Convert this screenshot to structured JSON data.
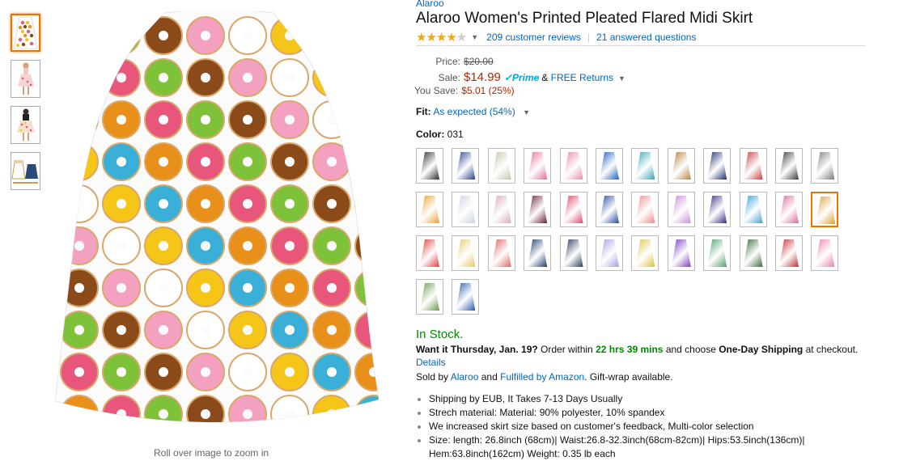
{
  "product": {
    "brand": "Alaroo",
    "title": "Alaroo Women's Printed Pleated Flared Midi Skirt",
    "rating_value": 4,
    "reviews_link": "209 customer reviews",
    "questions_link": "21 answered questions"
  },
  "price": {
    "price_label": "Price:",
    "list_price": "$20.00",
    "sale_label": "Sale:",
    "sale_price": "$14.99",
    "prime": "Prime",
    "returns_prefix": "&",
    "returns_link": "FREE Returns",
    "save_label": "You Save:",
    "save_value": "$5.01 (25%)"
  },
  "fit": {
    "label": "Fit:",
    "value": "As expected (54%)"
  },
  "color": {
    "label": "Color:",
    "value": "031"
  },
  "swatch_colors": [
    "#2b2b2b",
    "#2a3f8f",
    "#c9c2a8",
    "#e76c9b",
    "#e98aa8",
    "#1b5fbf",
    "#3aa3b5",
    "#b6813e",
    "#1e2f6b",
    "#c93c3c",
    "#3a3a3a",
    "#7a7a7a",
    "#e8a030",
    "#c9d3de",
    "#d8a9b8",
    "#6b1f3a",
    "#d94a6a",
    "#2a4aa0",
    "#f08a8a",
    "#c88ad8",
    "#3a2a80",
    "#3aa0d0",
    "#d86a9a",
    "#d9a23a",
    "#e03a3a",
    "#e8c86a",
    "#e06060",
    "#1e3a6a",
    "#2a3a5a",
    "#a0a0e0",
    "#e0c040",
    "#7a3ac0",
    "#4aa06a",
    "#3a6a3a",
    "#c03030",
    "#e880b0",
    "#6a9a4a",
    "#2a5ab0"
  ],
  "availability": {
    "stock": "In Stock.",
    "want_it": "Want it Thursday, Jan. 19?",
    "order_within": "Order within",
    "countdown": "22 hrs 39 mins",
    "and_choose": "and choose",
    "shipping_option": "One-Day Shipping",
    "at_checkout": "at checkout.",
    "details_link": "Details",
    "sold_by": "Sold by",
    "seller": "Alaroo",
    "and": "and",
    "fulfilled": "Fulfilled by Amazon",
    "gift": ". Gift-wrap available."
  },
  "bullets": [
    "Shipping by EUB, It Takes 7-13 Days Usually",
    "Strech material: Material: 90% polyester, 10% spandex",
    "We increased skirt size based on customer's feedback, Multi-color selection",
    "Size: length: 26.8inch (68cm)| Waist:26.8-32.3inch(68cm-82cm)| Hips:53.5inch(136cm)| Hem:63.8inch(162cm) Weight: 0.35 lb each"
  ],
  "image": {
    "zoom_hint": "Roll over image to zoom in"
  }
}
